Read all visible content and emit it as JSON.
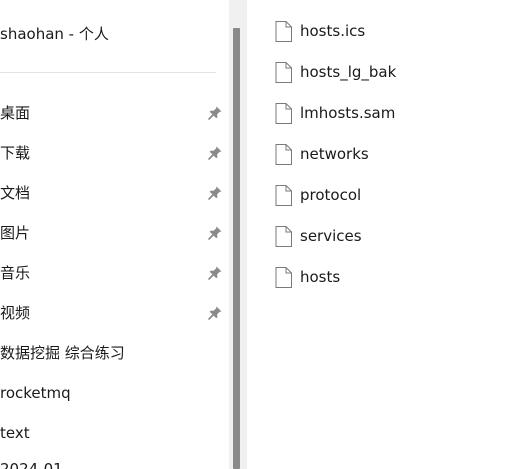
{
  "nav": {
    "header": "shaohan - 个人",
    "items": [
      {
        "label": "桌面",
        "pinned": true
      },
      {
        "label": "下载",
        "pinned": true
      },
      {
        "label": "文档",
        "pinned": true
      },
      {
        "label": "图片",
        "pinned": true
      },
      {
        "label": "音乐",
        "pinned": true
      },
      {
        "label": "视频",
        "pinned": true
      },
      {
        "label": "数据挖掘 综合练习",
        "pinned": false
      },
      {
        "label": "rocketmq",
        "pinned": false
      },
      {
        "label": "text",
        "pinned": false
      }
    ],
    "partial_item": "2024-01"
  },
  "files": [
    {
      "name": "hosts.ics",
      "icon": "file-icon"
    },
    {
      "name": "hosts_lg_bak",
      "icon": "file-icon"
    },
    {
      "name": "lmhosts.sam",
      "icon": "file-icon"
    },
    {
      "name": "networks",
      "icon": "file-icon"
    },
    {
      "name": "protocol",
      "icon": "file-icon"
    },
    {
      "name": "services",
      "icon": "file-icon"
    },
    {
      "name": "hosts",
      "icon": "file-icon"
    }
  ],
  "colors": {
    "pin": "#8a8a8a",
    "scroll_thumb": "#8a8a8a",
    "scroll_track": "#f0f0f0",
    "divider": "#e3e3e3"
  }
}
